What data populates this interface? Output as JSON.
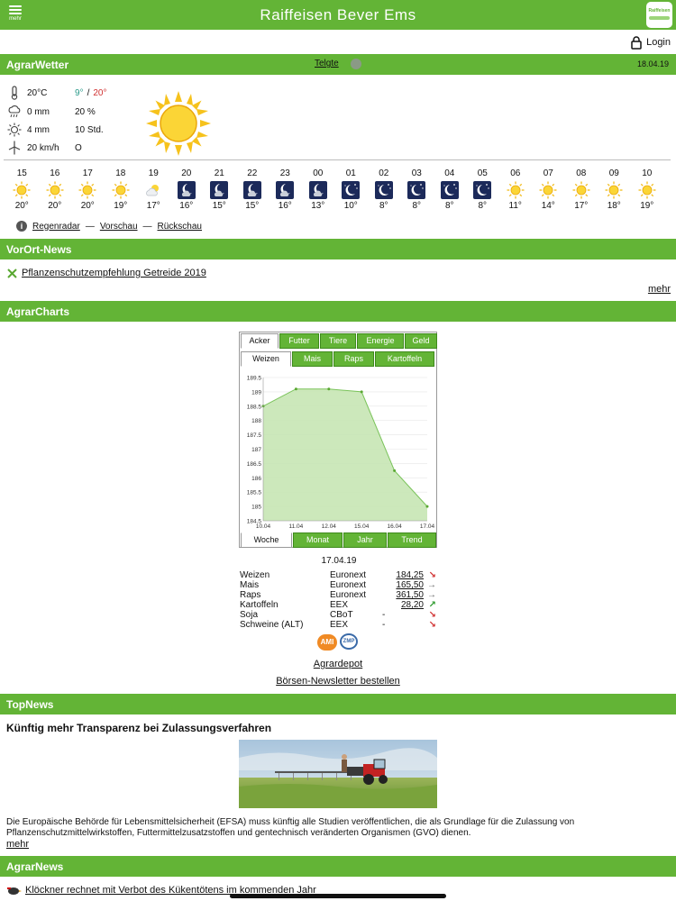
{
  "header": {
    "menu_label": "mehr",
    "title": "Raiffeisen Bever Ems",
    "logo_text": "Raiffeisen"
  },
  "login_label": "Login",
  "weather": {
    "section_title": "AgrarWetter",
    "location": "Telgte",
    "date": "18.04.19",
    "current": {
      "temp": "20°C",
      "low": "9°",
      "separator": "/",
      "high": "20°",
      "rain": "0 mm",
      "rain_prob": "20 %",
      "evap": "4 mm",
      "sun_hours": "10 Std.",
      "wind": "20 km/h",
      "wind_dir": "O"
    },
    "hourly": [
      {
        "hour": "15",
        "icon": "sun-icon",
        "temp": "20°"
      },
      {
        "hour": "16",
        "icon": "sun-icon",
        "temp": "20°"
      },
      {
        "hour": "17",
        "icon": "sun-icon",
        "temp": "20°"
      },
      {
        "hour": "18",
        "icon": "sun-icon",
        "temp": "19°"
      },
      {
        "hour": "19",
        "icon": "partly-cloudy-icon",
        "temp": "17°"
      },
      {
        "hour": "20",
        "icon": "moon-cloud-icon",
        "temp": "16°"
      },
      {
        "hour": "21",
        "icon": "moon-cloud-icon",
        "temp": "15°"
      },
      {
        "hour": "22",
        "icon": "moon-cloud-icon",
        "temp": "15°"
      },
      {
        "hour": "23",
        "icon": "moon-cloud-icon",
        "temp": "16°"
      },
      {
        "hour": "00",
        "icon": "moon-cloud-icon",
        "temp": "13°"
      },
      {
        "hour": "01",
        "icon": "moon-stars-icon",
        "temp": "10°"
      },
      {
        "hour": "02",
        "icon": "moon-stars-icon",
        "temp": "8°"
      },
      {
        "hour": "03",
        "icon": "moon-stars-icon",
        "temp": "8°"
      },
      {
        "hour": "04",
        "icon": "moon-stars-icon",
        "temp": "8°"
      },
      {
        "hour": "05",
        "icon": "moon-stars-icon",
        "temp": "8°"
      },
      {
        "hour": "06",
        "icon": "sun-icon",
        "temp": "11°"
      },
      {
        "hour": "07",
        "icon": "sun-icon",
        "temp": "14°"
      },
      {
        "hour": "08",
        "icon": "sun-icon",
        "temp": "17°"
      },
      {
        "hour": "09",
        "icon": "sun-icon",
        "temp": "18°"
      },
      {
        "hour": "10",
        "icon": "sun-icon",
        "temp": "19°"
      }
    ],
    "links": {
      "radar": "Regenradar",
      "dash1": "—",
      "preview": "Vorschau",
      "dash2": "—",
      "review": "Rückschau"
    }
  },
  "vorort": {
    "section_title": "VorOrt-News",
    "item": "Pflanzenschutzempfehlung Getreide 2019",
    "more": "mehr"
  },
  "charts": {
    "section_title": "AgrarCharts",
    "top_tabs": [
      "Acker",
      "Futter",
      "Tiere",
      "Energie",
      "Geld"
    ],
    "sub_tabs": [
      "Weizen",
      "Mais",
      "Raps",
      "Kartoffeln"
    ],
    "bottom_tabs": [
      "Woche",
      "Monat",
      "Jahr",
      "Trend"
    ],
    "quote_date": "17.04.19",
    "quotes": [
      {
        "name": "Weizen",
        "exchange": "Euronext",
        "price": "184,25",
        "trend": "down",
        "arrow": "↘"
      },
      {
        "name": "Mais",
        "exchange": "Euronext",
        "price": "165,50",
        "trend": "flat",
        "arrow": "→"
      },
      {
        "name": "Raps",
        "exchange": "Euronext",
        "price": "361,50",
        "trend": "flat",
        "arrow": "→"
      },
      {
        "name": "Kartoffeln",
        "exchange": "EEX",
        "price": "28,20",
        "trend": "up",
        "arrow": "↗"
      },
      {
        "name": "Soja",
        "exchange": "CBoT",
        "price": "-",
        "trend": "down",
        "arrow": "↘"
      },
      {
        "name": "Schweine (ALT)",
        "exchange": "EEX",
        "price": "-",
        "trend": "down",
        "arrow": "↘"
      }
    ],
    "ami": "AMI",
    "zmp": "ZMP",
    "agrardepot": "Agrardepot",
    "newsletter": "Börsen-Newsletter bestellen"
  },
  "chart_data": {
    "type": "area",
    "categories": [
      "10.04",
      "11.04",
      "12.04",
      "15.04",
      "16.04",
      "17.04"
    ],
    "values": [
      188.5,
      189.1,
      189.1,
      189.0,
      186.25,
      185.0
    ],
    "yticks": [
      184.5,
      185,
      185.5,
      186,
      186.5,
      187,
      187.5,
      188,
      188.5,
      189,
      189.5
    ],
    "ylim": [
      184.5,
      189.5
    ],
    "line_color": "#7ac35a",
    "fill_color": "#c7e6b4"
  },
  "topnews": {
    "section_title": "TopNews",
    "headline": "Künftig mehr Transparenz bei Zulassungsverfahren",
    "text": "Die Europäische Behörde für Lebensmittelsicherheit (EFSA) muss künftig alle Studien veröffentlichen, die als Grundlage für die Zulassung von Pflanzenschutzmittelwirkstoffen, Futtermittelzusatzstoffen und gentechnisch veränderten Organismen (GVO) dienen.",
    "more": "mehr"
  },
  "agrarnews": {
    "section_title": "AgrarNews",
    "item": "Klöckner rechnet mit Verbot des Kükentötens im kommenden Jahr"
  },
  "colors": {
    "brand_green": "#63b436"
  }
}
